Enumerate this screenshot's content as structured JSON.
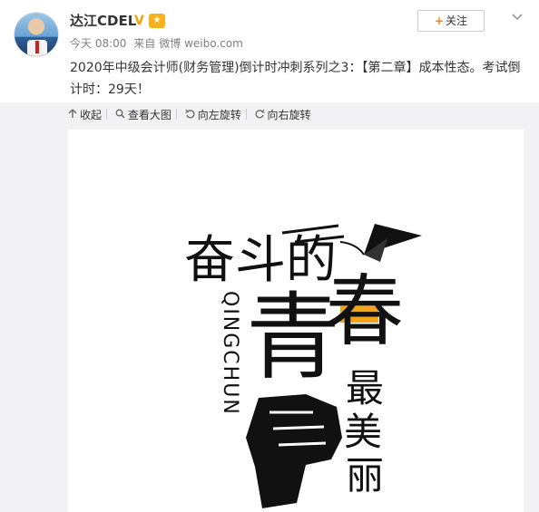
{
  "post": {
    "author": {
      "name": "达江CDEL",
      "verified_icon": "v-badge-icon",
      "level_icon": "vip-badge-icon"
    },
    "meta": {
      "time": "今天 08:00",
      "source_prefix": "来自",
      "source": "微博 weibo.com"
    },
    "follow_label": "关注",
    "text": "2020年中级会计师(财务管理)倒计时冲刺系列之3：【第二章】成本性态。考试倒计时：29天！"
  },
  "toolbar": {
    "items": [
      {
        "label": "收起",
        "icon": "collapse-icon"
      },
      {
        "label": "查看大图",
        "icon": "zoom-icon"
      },
      {
        "label": "向左旋转",
        "icon": "rotate-left-icon"
      },
      {
        "label": "向右旋转",
        "icon": "rotate-right-icon"
      }
    ]
  },
  "poster": {
    "line1": "奋斗的",
    "big_chars": [
      "青",
      "春"
    ],
    "vertical_en": "QINGCHUN",
    "vertical_cn": [
      "最",
      "美",
      "丽"
    ],
    "colors": {
      "ink": "#111111",
      "accent": "#f3a21b"
    }
  }
}
